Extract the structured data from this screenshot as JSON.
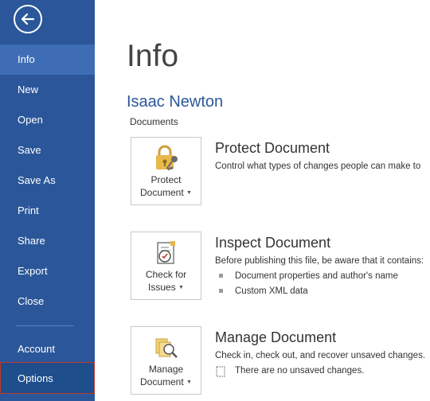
{
  "sidebar": {
    "items": [
      {
        "label": "Info"
      },
      {
        "label": "New"
      },
      {
        "label": "Open"
      },
      {
        "label": "Save"
      },
      {
        "label": "Save As"
      },
      {
        "label": "Print"
      },
      {
        "label": "Share"
      },
      {
        "label": "Export"
      },
      {
        "label": "Close"
      },
      {
        "label": "Account"
      },
      {
        "label": "Options"
      }
    ],
    "active": "Info",
    "color": "#2b579a"
  },
  "main": {
    "title": "Info",
    "doc_name": "Isaac Newton",
    "doc_location": "Documents",
    "sections": [
      {
        "button_line1": "Protect",
        "button_line2": "Document",
        "icon": "lock-key-icon",
        "title": "Protect Document",
        "description": "Control what types of changes people can make to"
      },
      {
        "button_line1": "Check for",
        "button_line2": "Issues",
        "icon": "inspect-document-icon",
        "title": "Inspect Document",
        "description": "Before publishing this file, be aware that it contains:",
        "bullets": [
          "Document properties and author's name",
          "Custom XML data"
        ]
      },
      {
        "button_line1": "Manage",
        "button_line2": "Document",
        "icon": "manage-document-icon",
        "title": "Manage Document",
        "description": "Check in, check out, and recover unsaved changes.",
        "note": "There are no unsaved changes."
      }
    ]
  }
}
